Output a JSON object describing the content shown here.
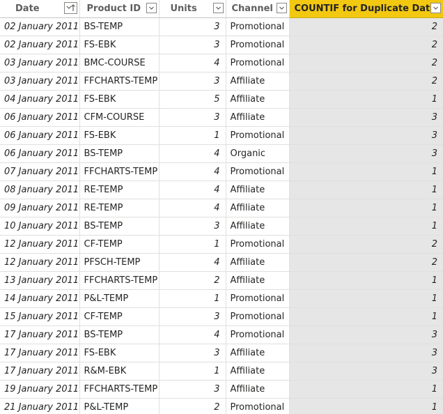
{
  "table": {
    "columns": [
      {
        "label": "Date",
        "filter_icon": "sort-ascending-filter-icon"
      },
      {
        "label": "Product ID",
        "filter_icon": "dropdown-filter-icon"
      },
      {
        "label": "Units",
        "filter_icon": "dropdown-filter-icon"
      },
      {
        "label": "Channel",
        "filter_icon": "dropdown-filter-icon"
      },
      {
        "label": "COUNTIF for Duplicate Dates",
        "filter_icon": "dropdown-filter-icon"
      }
    ],
    "rows": [
      [
        "02 January 2011",
        "BS-TEMP",
        "3",
        "Promotional",
        "2"
      ],
      [
        "02 January 2011",
        "FS-EBK",
        "3",
        "Promotional",
        "2"
      ],
      [
        "03 January 2011",
        "BMC-COURSE",
        "4",
        "Promotional",
        "2"
      ],
      [
        "03 January 2011",
        "FFCHARTS-TEMP",
        "3",
        "Affiliate",
        "2"
      ],
      [
        "04 January 2011",
        "FS-EBK",
        "5",
        "Affiliate",
        "1"
      ],
      [
        "06 January 2011",
        "CFM-COURSE",
        "3",
        "Affiliate",
        "3"
      ],
      [
        "06 January 2011",
        "FS-EBK",
        "1",
        "Promotional",
        "3"
      ],
      [
        "06 January 2011",
        "BS-TEMP",
        "4",
        "Organic",
        "3"
      ],
      [
        "07 January 2011",
        "FFCHARTS-TEMP",
        "4",
        "Promotional",
        "1"
      ],
      [
        "08 January 2011",
        "RE-TEMP",
        "4",
        "Affiliate",
        "1"
      ],
      [
        "09 January 2011",
        "RE-TEMP",
        "4",
        "Affiliate",
        "1"
      ],
      [
        "10 January 2011",
        "BS-TEMP",
        "3",
        "Affiliate",
        "1"
      ],
      [
        "12 January 2011",
        "CF-TEMP",
        "1",
        "Promotional",
        "2"
      ],
      [
        "12 January 2011",
        "PFSCH-TEMP",
        "4",
        "Affiliate",
        "2"
      ],
      [
        "13 January 2011",
        "FFCHARTS-TEMP",
        "2",
        "Affiliate",
        "1"
      ],
      [
        "14 January 2011",
        "P&L-TEMP",
        "1",
        "Promotional",
        "1"
      ],
      [
        "15 January 2011",
        "CF-TEMP",
        "3",
        "Promotional",
        "1"
      ],
      [
        "17 January 2011",
        "BS-TEMP",
        "4",
        "Promotional",
        "3"
      ],
      [
        "17 January 2011",
        "FS-EBK",
        "3",
        "Affiliate",
        "3"
      ],
      [
        "17 January 2011",
        "R&M-EBK",
        "1",
        "Affiliate",
        "3"
      ],
      [
        "19 January 2011",
        "FFCHARTS-TEMP",
        "3",
        "Affiliate",
        "1"
      ],
      [
        "21 January 2011",
        "P&L-TEMP",
        "2",
        "Promotional",
        "1"
      ]
    ]
  },
  "colors": {
    "highlight_header": "#f2c811",
    "highlight_column": "#e6e6e6",
    "grid_line": "#e1dfdd"
  }
}
